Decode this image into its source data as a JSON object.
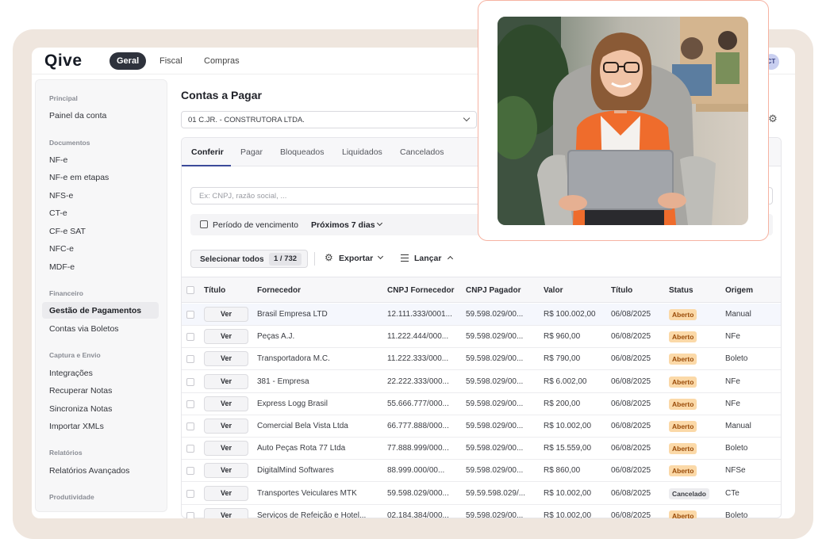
{
  "app": {
    "logo": "Qive",
    "nav": [
      "Geral",
      "Fiscal",
      "Compras"
    ],
    "avatar_initials": "CT"
  },
  "sidebar": {
    "sections": [
      {
        "title": "Principal",
        "items": [
          "Painel da conta"
        ]
      },
      {
        "title": "Documentos",
        "items": [
          "NF-e",
          "NF-e em etapas",
          "NFS-e",
          "CT-e",
          "CF-e SAT",
          "NFC-e",
          "MDF-e"
        ]
      },
      {
        "title": "Financeiro",
        "items": [
          "Gestão de Pagamentos",
          "Contas via Boletos"
        ]
      },
      {
        "title": "Captura e Envio",
        "items": [
          "Integrações",
          "Recuperar Notas",
          "Sincroniza Notas",
          "Importar XMLs"
        ]
      },
      {
        "title": "Relatórios",
        "items": [
          "Relatórios Avançados"
        ]
      },
      {
        "title": "Produtividade",
        "items": []
      }
    ],
    "active_item": "Gestão de Pagamentos"
  },
  "main": {
    "title": "Contas a Pagar",
    "company": "01 C.JR. - CONSTRUTORA LTDA.",
    "tabs": [
      "Conferir",
      "Pagar",
      "Bloqueados",
      "Liquidados",
      "Cancelados"
    ],
    "active_tab": "Conferir",
    "search_placeholder": "Ex: CNPJ, razão social, ...",
    "filter_label": "Período de vencimento",
    "filter_value": "Próximos 7 dias",
    "select_all_label": "Selecionar todos",
    "select_count": "1 / 732",
    "export_label": "Exportar",
    "launch_label": "Lançar",
    "ver_label": "Ver"
  },
  "table": {
    "columns": [
      "Título",
      "Fornecedor",
      "CNPJ Fornecedor",
      "CNPJ Pagador",
      "Valor",
      "Título",
      "Status",
      "Origem"
    ],
    "rows": [
      [
        "Brasil Empresa LTD",
        "12.111.333/0001...",
        "59.598.029/00...",
        "R$ 100.002,00",
        "06/08/2025",
        "Aberto",
        "Manual"
      ],
      [
        "Peças A.J.",
        "11.222.444/000...",
        "59.598.029/00...",
        "R$ 960,00",
        "06/08/2025",
        "Aberto",
        "NFe"
      ],
      [
        "Transportadora M.C.",
        "11.222.333/000...",
        "59.598.029/00...",
        "R$ 790,00",
        "06/08/2025",
        "Aberto",
        "Boleto"
      ],
      [
        "381 - Empresa",
        "22.222.333/000...",
        "59.598.029/00...",
        "R$ 6.002,00",
        "06/08/2025",
        "Aberto",
        "NFe"
      ],
      [
        "Express Logg Brasil",
        "55.666.777/000...",
        "59.598.029/00...",
        "R$ 200,00",
        "06/08/2025",
        "Aberto",
        "NFe"
      ],
      [
        "Comercial Bela Vista Ltda",
        "66.777.888/000...",
        "59.598.029/00...",
        "R$ 10.002,00",
        "06/08/2025",
        "Aberto",
        "Manual"
      ],
      [
        "Auto Peças Rota 77 Ltda",
        "77.888.999/000...",
        "59.598.029/00...",
        "R$ 15.559,00",
        "06/08/2025",
        "Aberto",
        "Boleto"
      ],
      [
        "DigitalMind Softwares",
        "88.999.000/00...",
        "59.598.029/00...",
        "R$ 860,00",
        "06/08/2025",
        "Aberto",
        "NFSe"
      ],
      [
        "Transportes Veiculares MTK",
        "59.598.029/000...",
        "59.59.598.029/...",
        "R$ 10.002,00",
        "06/08/2025",
        "Cancelado",
        "CTe"
      ],
      [
        "Serviços de Refeição e Hotel...",
        "02.184.384/000...",
        "59.598.029/00...",
        "R$ 10.002,00",
        "06/08/2025",
        "Aberto",
        "Boleto"
      ]
    ]
  },
  "colors": {
    "accent": "#3b4a9a",
    "badge_aberto": "#fbd9a8",
    "background_card": "#efe6de",
    "photo_border": "#f6b3a2"
  }
}
